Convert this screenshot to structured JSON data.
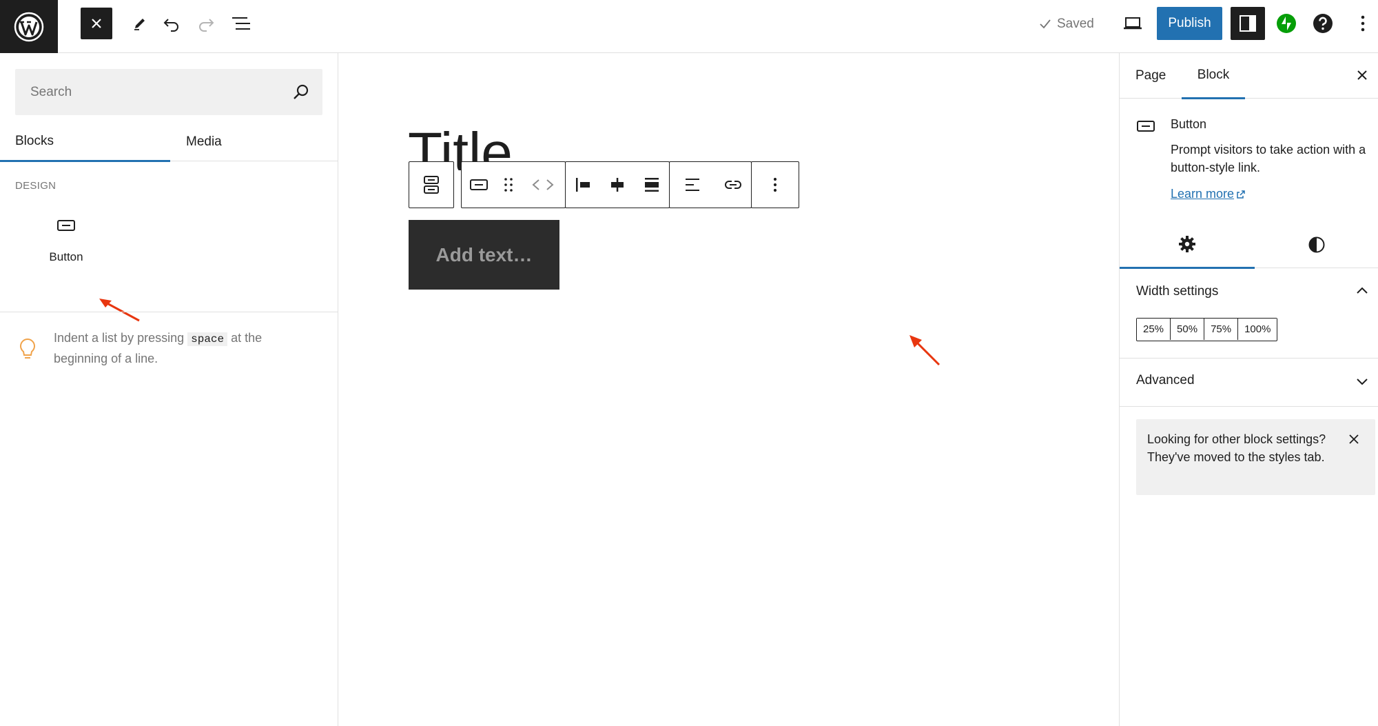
{
  "topbar": {
    "logo_icon": "wordpress-logo",
    "saved_label": "Saved",
    "publish_label": "Publish",
    "accent_color": "#2271b1",
    "jetpack_color": "#069e08"
  },
  "inserter": {
    "search_placeholder": "Search",
    "tabs": [
      {
        "label": "Blocks",
        "active": true
      },
      {
        "label": "Media",
        "active": false
      }
    ],
    "category_heading": "DESIGN",
    "blocks": [
      {
        "label": "Button",
        "icon": "button-block-icon"
      }
    ],
    "tip": {
      "before": "Indent a list by pressing",
      "code": "space",
      "after": "at the beginning of a line."
    }
  },
  "editor": {
    "title": "Title",
    "button_placeholder": "Add text…",
    "toolbar_icons": [
      "buttons-parent-icon",
      "button-block-icon",
      "drag-handle-icon",
      "move-arrows-icon",
      "justify-left-icon",
      "justify-center-icon",
      "justify-space-between-icon",
      "align-left-icon",
      "link-icon",
      "more-options-icon"
    ]
  },
  "sidebar": {
    "tabs": [
      {
        "label": "Page",
        "active": false
      },
      {
        "label": "Block",
        "active": true
      }
    ],
    "block_card": {
      "title": "Button",
      "description": "Prompt visitors to take action with a button-style link.",
      "learn_more": "Learn more"
    },
    "sub_tabs": [
      "settings-gear-icon",
      "styles-contrast-icon"
    ],
    "width_settings": {
      "heading": "Width settings",
      "options": [
        "25%",
        "50%",
        "75%",
        "100%"
      ]
    },
    "advanced_heading": "Advanced",
    "notice": "Looking for other block settings? They've moved to the styles tab."
  },
  "annotations": {
    "arrow_color": "#e8360f"
  }
}
